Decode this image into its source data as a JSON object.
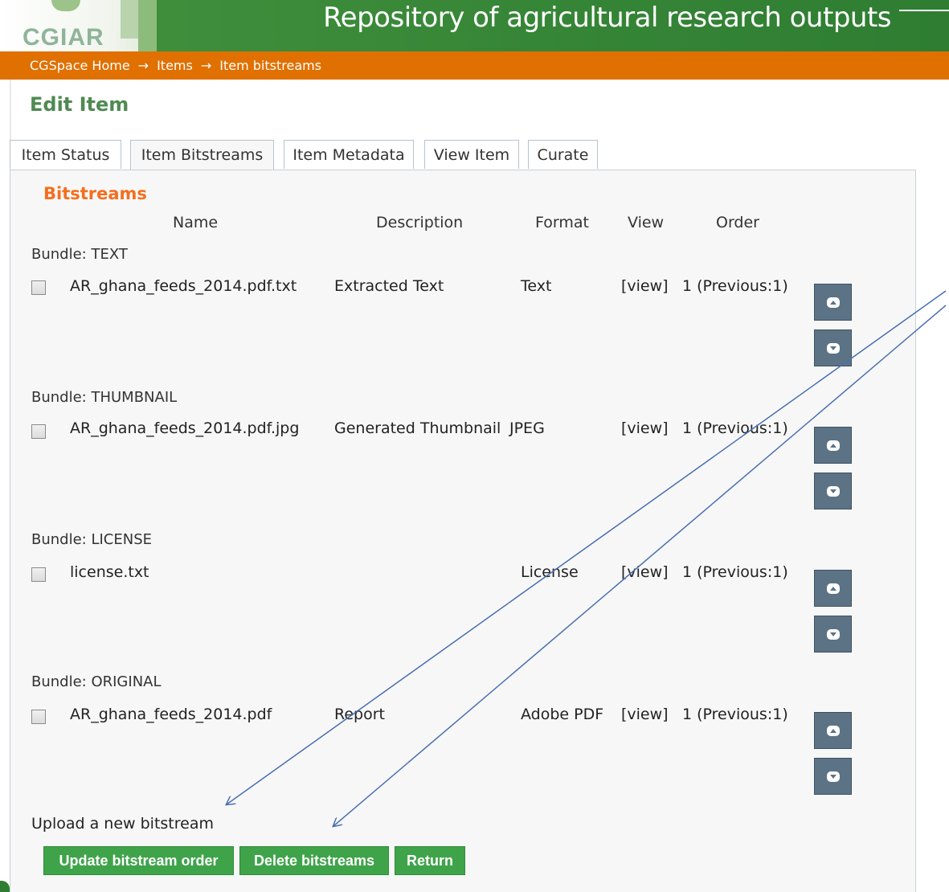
{
  "header": {
    "logo_text": "CGIAR",
    "title": "Repository of agricultural research outputs"
  },
  "breadcrumb": {
    "items": [
      "CGSpace Home",
      "Items",
      "Item bitstreams"
    ],
    "separator": "→"
  },
  "page_title": "Edit Item",
  "tabs": [
    {
      "label": "Item Status"
    },
    {
      "label": "Item Bitstreams",
      "active": true
    },
    {
      "label": "Item Metadata"
    },
    {
      "label": "View Item"
    },
    {
      "label": "Curate"
    }
  ],
  "section_title": "Bitstreams",
  "columns": [
    "Name",
    "Description",
    "Format",
    "View",
    "Order"
  ],
  "bundles": [
    {
      "label": "Bundle: TEXT",
      "name": "AR_ghana_feeds_2014.pdf.txt",
      "description": "Extracted Text",
      "format": "Text",
      "view": "[view]",
      "order": "1 (Previous:1)"
    },
    {
      "label": "Bundle: THUMBNAIL",
      "name": "AR_ghana_feeds_2014.pdf.jpg",
      "description": "Generated Thumbnail",
      "format": "JPEG",
      "view": "[view]",
      "order": "1 (Previous:1)"
    },
    {
      "label": "Bundle: LICENSE",
      "name": "license.txt",
      "description": "",
      "format": "License",
      "view": "[view]",
      "order": "1 (Previous:1)"
    },
    {
      "label": "Bundle: ORIGINAL",
      "name": "AR_ghana_feeds_2014.pdf",
      "description": "Report",
      "format": "Adobe PDF",
      "view": "[view]",
      "order": "1 (Previous:1)"
    }
  ],
  "upload_label": "Upload a new bitstream",
  "buttons": {
    "update_order": "Update bitstream order",
    "delete": "Delete bitstreams",
    "return": "Return"
  },
  "colors": {
    "header_green": "#2e7d32",
    "breadcrumb_orange": "#e07000",
    "title_green": "#4f8a52",
    "section_orange": "#f36f1f",
    "button_green": "#3fa34a",
    "order_button": "#5c7386",
    "annotation_arrow": "#4a6fb0"
  },
  "icons": {
    "move_up": "chevron-up-icon",
    "move_down": "chevron-down-icon"
  }
}
